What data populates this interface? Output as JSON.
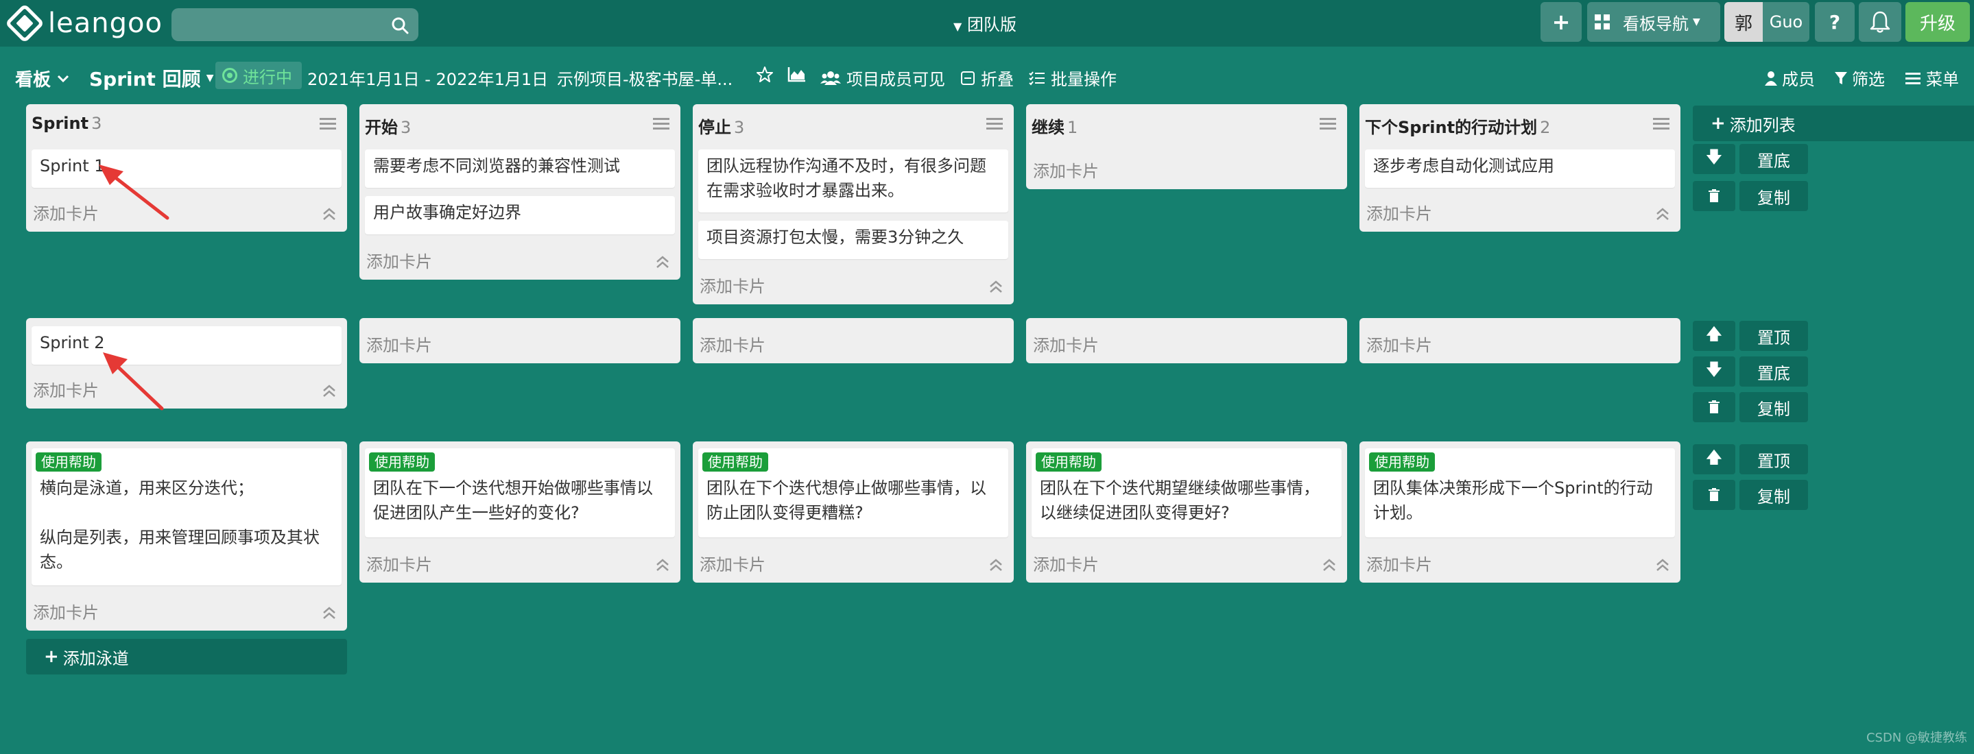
{
  "app": {
    "logo_text": "leangoo",
    "edition": "团队版",
    "search": {
      "placeholder": ""
    }
  },
  "topbar": {
    "add_label": "+",
    "board_nav_label": "看板导航",
    "user_zh": "郭",
    "user_en": "Guo",
    "help_label": "?",
    "upgrade_label": "升级"
  },
  "boardbar": {
    "view_label": "看板",
    "board_name": "Sprint 回顾",
    "status_label": "进行中",
    "date_range": "2021年1月1日 - 2022年1月1日",
    "project_name": "示例项目-极客书屋-单...",
    "visibility_label": "项目成员可见",
    "fold_label": "折叠",
    "batch_label": "批量操作",
    "members_label": "成员",
    "filter_label": "筛选",
    "menu_label": "菜单"
  },
  "columns": [
    {
      "title": "Sprint",
      "count": "3"
    },
    {
      "title": "开始",
      "count": "3"
    },
    {
      "title": "停止",
      "count": "3"
    },
    {
      "title": "继续",
      "count": "1"
    },
    {
      "title": "下个Sprint的行动计划",
      "count": "2"
    }
  ],
  "lanes": [
    {
      "cards": [
        [
          "Sprint 1"
        ],
        [
          "需要考虑不同浏览器的兼容性测试",
          "用户故事确定好边界"
        ],
        [
          "团队远程协作沟通不及时，有很多问题在需求验收时才暴露出来。",
          "项目资源打包太慢，需要3分钟之久"
        ],
        [],
        [
          "逐步考虑自动化测试应用"
        ]
      ]
    },
    {
      "cards": [
        [
          "Sprint 2"
        ],
        [],
        [],
        [],
        []
      ]
    },
    {
      "help_badge": "使用帮助",
      "cards": [
        [
          "横向是泳道，用来区分迭代；",
          "纵向是列表，用来管理回顾事项及其状态。"
        ],
        [
          "团队在下一个迭代想开始做哪些事情以促进团队产生一些好的变化?"
        ],
        [
          "团队在下个迭代想停止做哪些事情，以防止团队变得更糟糕?"
        ],
        [
          "团队在下个迭代期望继续做哪些事情，以继续促进团队变得更好?"
        ],
        [
          "团队集体决策形成下一个Sprint的行动计划。"
        ]
      ]
    }
  ],
  "add_card_label": "添加卡片",
  "add_list_label": "添加列表",
  "add_lane_label": "添加泳道",
  "actions": {
    "to_top": "置顶",
    "to_bottom": "置底",
    "copy": "复制"
  },
  "watermark": "CSDN @敏捷教练",
  "colors": {
    "board_bg": "#15806f",
    "bar_bg": "#0e6b5d",
    "status_green": "#6fe39a",
    "help_badge": "#1b9e3a",
    "upgrade": "#5cb85c",
    "annotation_arrow": "#e53935"
  }
}
